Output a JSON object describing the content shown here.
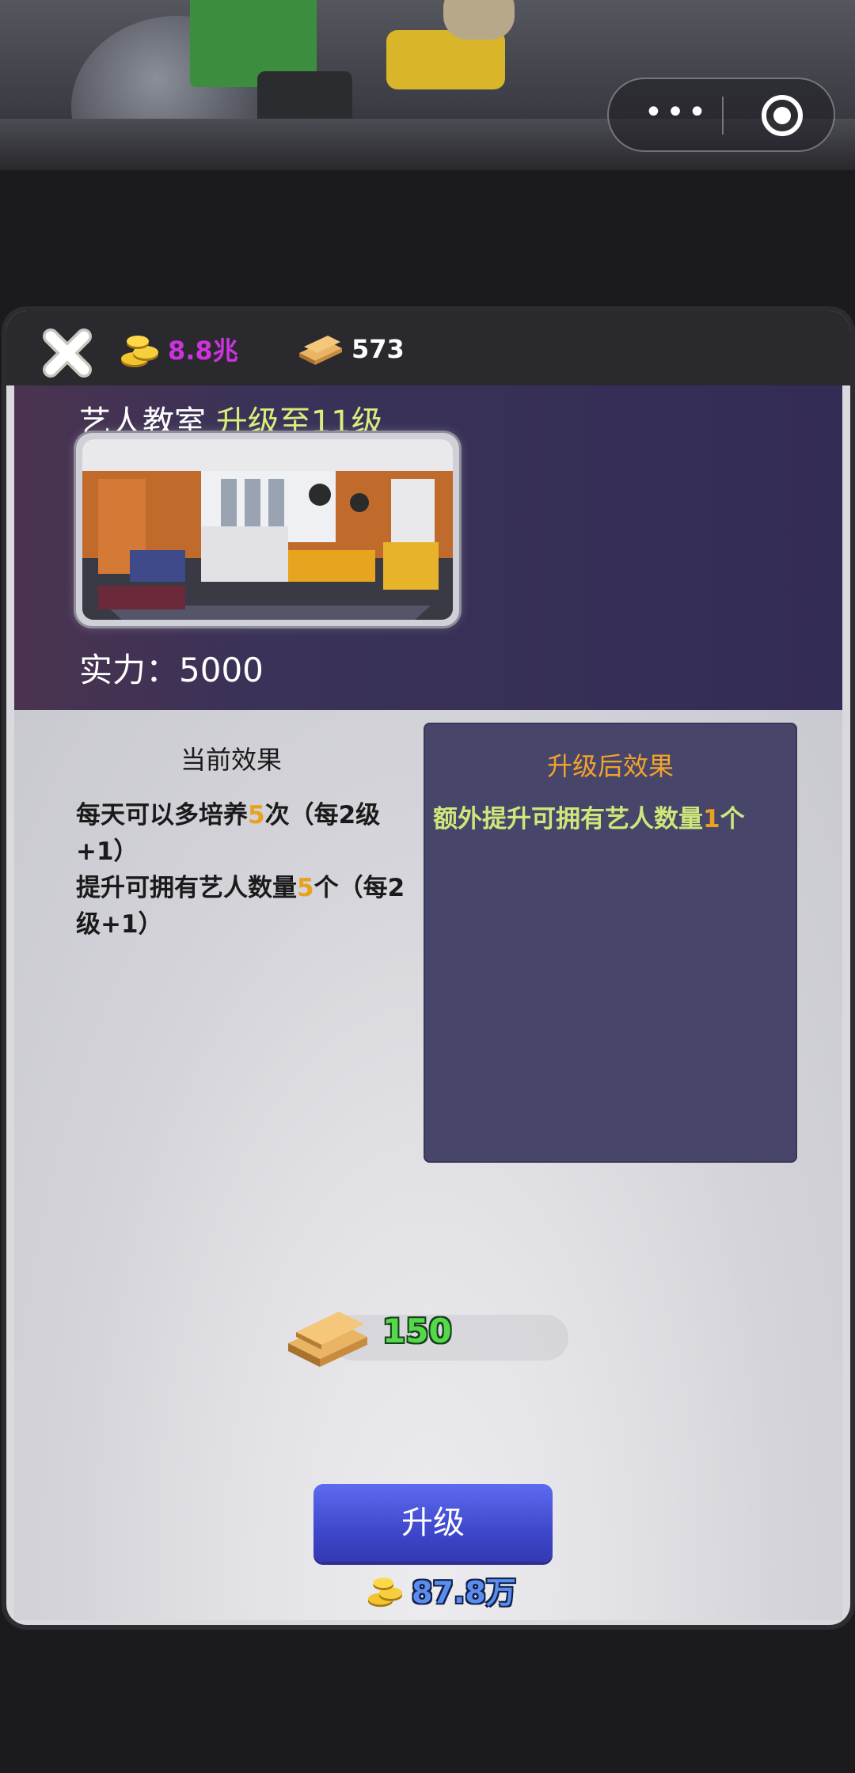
{
  "capsule": {
    "more": "•••",
    "more_icon": "more-dots-icon",
    "target_icon": "target-icon"
  },
  "resources": {
    "gold": {
      "value": "8.8兆",
      "color": "#cc33dd",
      "icon": "gold-coins-icon"
    },
    "bars": {
      "value": "573",
      "color": "#ffffff",
      "icon": "gold-bars-icon"
    }
  },
  "building": {
    "name": "艺人教室",
    "upgrade_to": "升级至11级",
    "power_label": "实力：",
    "power_value": "5000"
  },
  "current_effect": {
    "title": "当前效果",
    "line1_a": "每天可以多培养",
    "line1_num": "5",
    "line1_b": "次（每2级+1）",
    "line2_a": "提升可拥有艺人数量",
    "line2_num": "5",
    "line2_b": "个（每2级+1）"
  },
  "after_effect": {
    "title": "升级后效果",
    "line_a": "额外提升可拥有艺人数量",
    "line_num": "1",
    "line_b": "个"
  },
  "cost": {
    "value": "150",
    "icon": "gold-bars-icon"
  },
  "upgrade_button": {
    "label": "升级"
  },
  "price": {
    "value": "87.8万",
    "icon": "gold-coins-icon"
  },
  "colors": {
    "highlight": "#d9ee7c",
    "number": "#e8a21d",
    "after_text": "#cfe77a",
    "after_title": "#f1a32b",
    "button": "#4450d8"
  }
}
